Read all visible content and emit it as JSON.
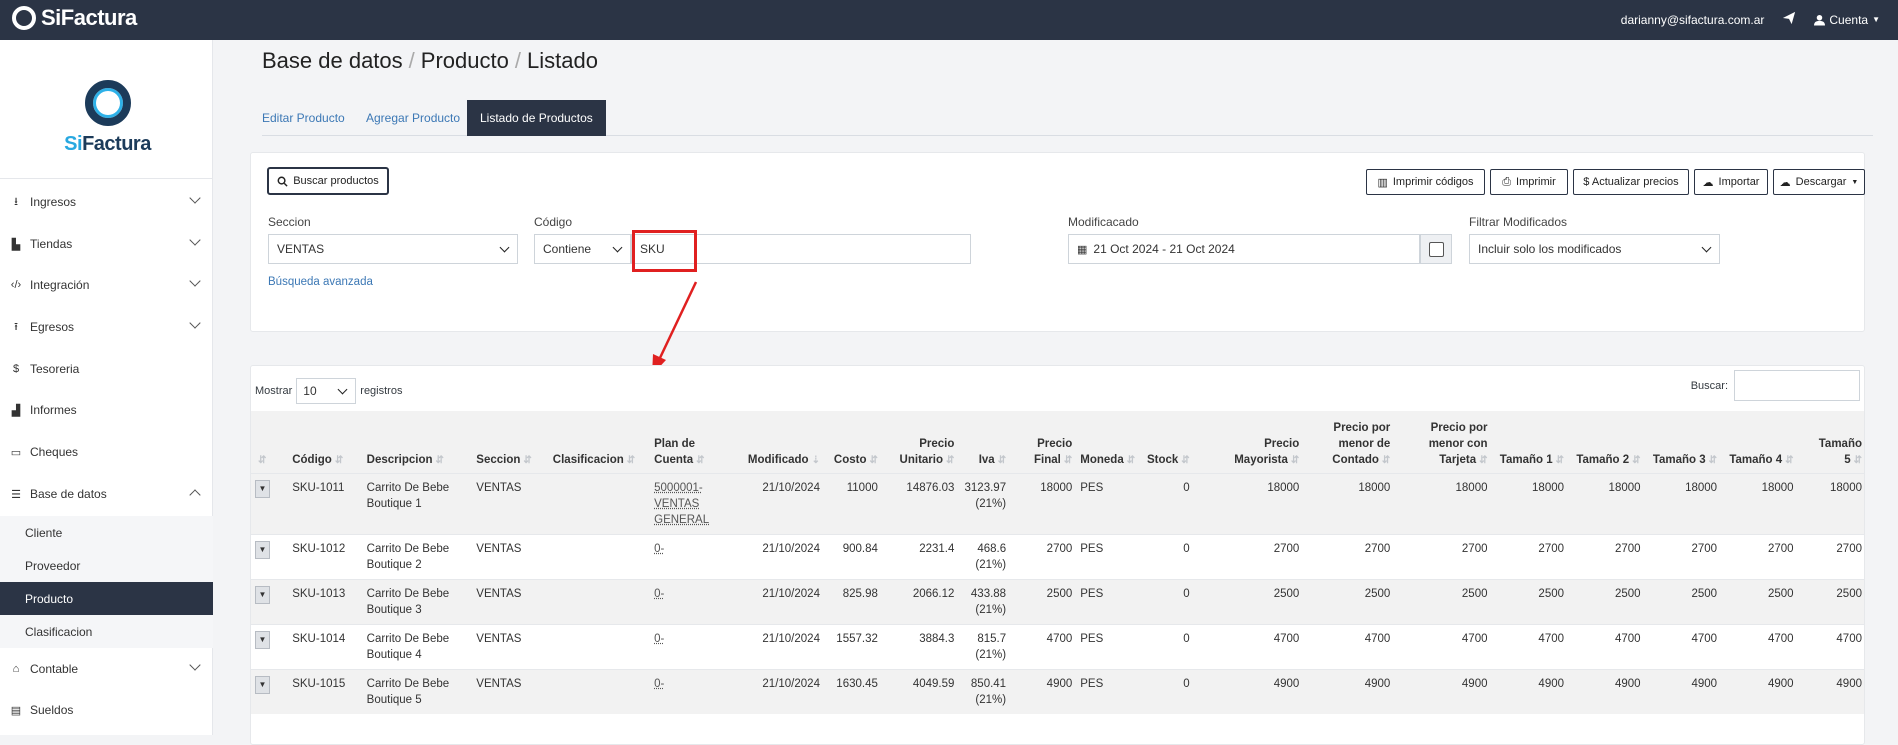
{
  "app": {
    "brand": "SiFactura",
    "user_email": "darianny@sifactura.com.ar",
    "account_label": "Cuenta"
  },
  "logo": {
    "word_a": "Si",
    "word_b": "Factura"
  },
  "sidebar": {
    "items": [
      {
        "label": "Ingresos",
        "icon": "download-icon"
      },
      {
        "label": "Tiendas",
        "icon": "store-icon"
      },
      {
        "label": "Integración",
        "icon": "code-icon"
      },
      {
        "label": "Egresos",
        "icon": "upload-icon"
      },
      {
        "label": "Tesoreria",
        "icon": "dollar-icon"
      },
      {
        "label": "Informes",
        "icon": "chart-icon"
      },
      {
        "label": "Cheques",
        "icon": "card-icon"
      },
      {
        "label": "Base de datos",
        "icon": "database-icon"
      },
      {
        "label": "Contable",
        "icon": "bank-icon"
      },
      {
        "label": "Sueldos",
        "icon": "book-icon"
      }
    ],
    "subitems": [
      "Cliente",
      "Proveedor",
      "Producto",
      "Clasificacion"
    ]
  },
  "breadcrumb": [
    "Base de datos",
    "Producto",
    "Listado"
  ],
  "tabs": [
    "Editar Producto",
    "Agregar Producto",
    "Listado de Productos"
  ],
  "filters": {
    "search_button": "Buscar productos",
    "actions": [
      "Imprimir códigos",
      "Imprimir",
      "$ Actualizar precios",
      "Importar",
      "Descargar"
    ],
    "seccion_label": "Seccion",
    "seccion_value": "VENTAS",
    "codigo_label": "Código",
    "codigo_mode": "Contiene",
    "codigo_value": "SKU",
    "modificado_label": "Modificacado",
    "modificado_value": "21 Oct 2024 - 21 Oct 2024",
    "filtrar_label": "Filtrar Modificados",
    "filtrar_value": "Incluir solo los modificados",
    "advanced_link": "Búsqueda avanzada"
  },
  "table": {
    "show_label": "Mostrar",
    "page_size": "10",
    "records_label": "registros",
    "search_label": "Buscar:",
    "headers": [
      "Código",
      "Descripcion",
      "Seccion",
      "Clasificacion",
      "Plan de Cuenta",
      "Modificado",
      "Costo",
      "Precio Unitario",
      "Iva",
      "Precio Final",
      "Moneda",
      "Stock",
      "Precio Mayorista",
      "Precio por menor de Contado",
      "Precio por menor con Tarjeta",
      "Tamaño 1",
      "Tamaño 2",
      "Tamaño 3",
      "Tamaño 4",
      "Tamaño 5"
    ],
    "rows": [
      [
        "SKU-1011",
        "Carrito De Bebe Boutique 1",
        "VENTAS",
        "",
        "5000001- VENTAS GENERAL",
        "21/10/2024",
        "11000",
        "14876.03",
        "3123.97 (21%)",
        "18000",
        "PES",
        "0",
        "18000",
        "18000",
        "18000",
        "18000",
        "18000",
        "18000",
        "18000",
        "18000"
      ],
      [
        "SKU-1012",
        "Carrito De Bebe Boutique 2",
        "VENTAS",
        "",
        "0-",
        "21/10/2024",
        "900.84",
        "2231.4",
        "468.6 (21%)",
        "2700",
        "PES",
        "0",
        "2700",
        "2700",
        "2700",
        "2700",
        "2700",
        "2700",
        "2700",
        "2700"
      ],
      [
        "SKU-1013",
        "Carrito De Bebe Boutique 3",
        "VENTAS",
        "",
        "0-",
        "21/10/2024",
        "825.98",
        "2066.12",
        "433.88 (21%)",
        "2500",
        "PES",
        "0",
        "2500",
        "2500",
        "2500",
        "2500",
        "2500",
        "2500",
        "2500",
        "2500"
      ],
      [
        "SKU-1014",
        "Carrito De Bebe Boutique 4",
        "VENTAS",
        "",
        "0-",
        "21/10/2024",
        "1557.32",
        "3884.3",
        "815.7 (21%)",
        "4700",
        "PES",
        "0",
        "4700",
        "4700",
        "4700",
        "4700",
        "4700",
        "4700",
        "4700",
        "4700"
      ],
      [
        "SKU-1015",
        "Carrito De Bebe Boutique 5",
        "VENTAS",
        "",
        "0-",
        "21/10/2024",
        "1630.45",
        "4049.59",
        "850.41 (21%)",
        "4900",
        "PES",
        "0",
        "4900",
        "4900",
        "4900",
        "4900",
        "4900",
        "4900",
        "4900",
        "4900"
      ]
    ]
  },
  "colors": {
    "navbar": "#2b3445",
    "accent": "#3c78b5",
    "highlight": "#e02020"
  }
}
